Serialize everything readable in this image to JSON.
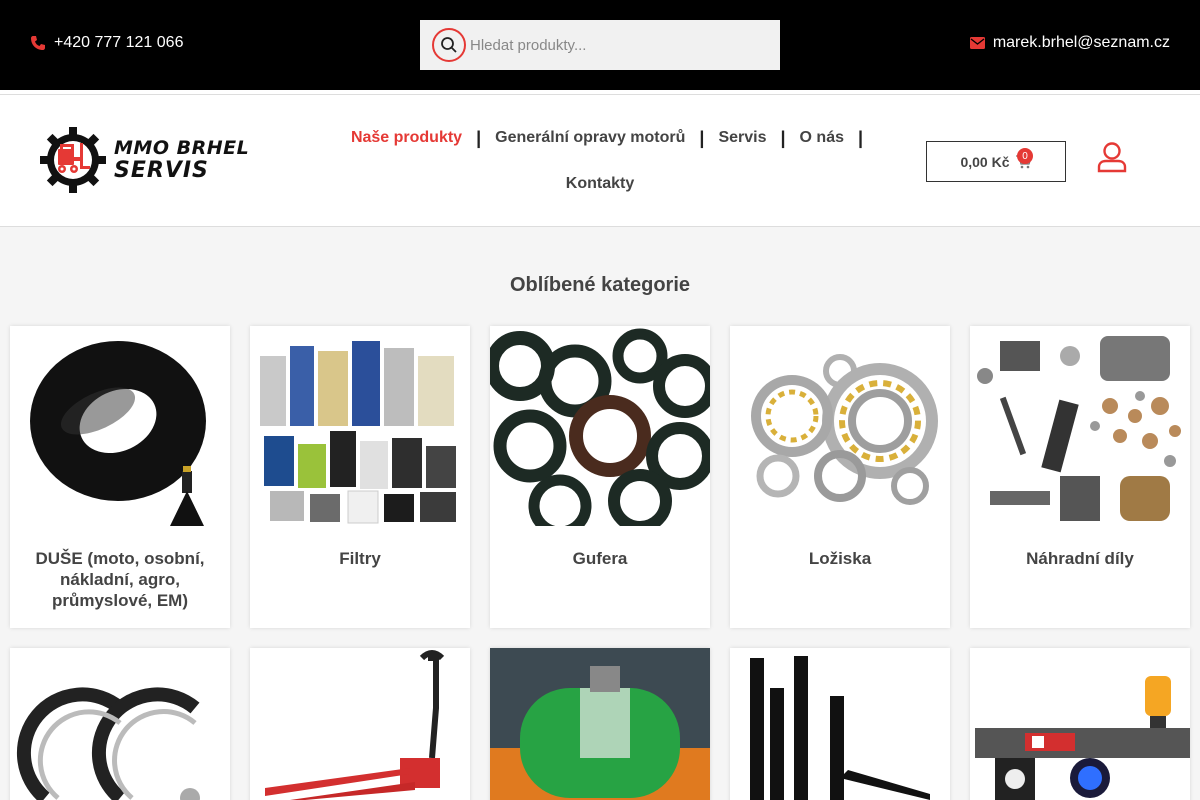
{
  "topbar": {
    "phone": "+420 777 121 066",
    "search_placeholder": "Hledat produkty...",
    "email": "marek.brhel@seznam.cz"
  },
  "logo": {
    "line1": "MMO BRHEL",
    "line2": "SERVIS"
  },
  "nav": {
    "items": [
      {
        "label": "Naše produkty",
        "active": true
      },
      {
        "label": "Generální opravy motorů"
      },
      {
        "label": "Servis"
      },
      {
        "label": "O nás"
      },
      {
        "label": "Kontakty"
      }
    ]
  },
  "cart": {
    "total": "0,00 Kč",
    "count": "0"
  },
  "section": {
    "title": "Oblíbené kategorie"
  },
  "categories_row1": [
    {
      "label": "DUŠE (moto, osobní, nákladní, agro, průmyslové, EM)"
    },
    {
      "label": "Filtry"
    },
    {
      "label": "Gufera"
    },
    {
      "label": "Ložiska"
    },
    {
      "label": "Náhradní díly"
    }
  ],
  "colors": {
    "accent": "#e53935",
    "topbar": "#000000"
  },
  "icons": [
    "phone-icon",
    "search-icon",
    "envelope-icon",
    "cart-icon",
    "user-icon"
  ]
}
